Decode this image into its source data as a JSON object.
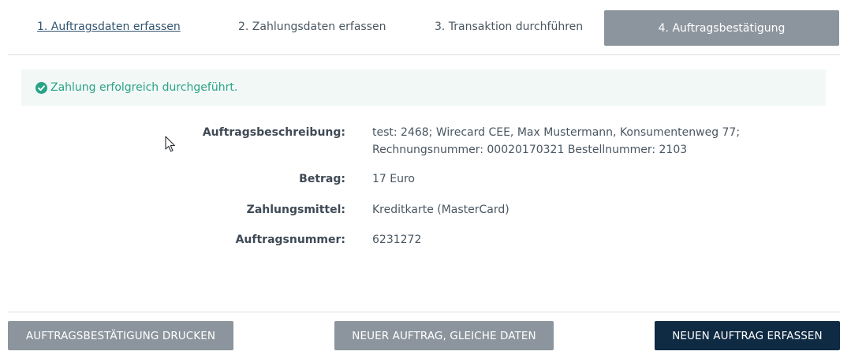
{
  "steps": [
    {
      "label": "1. Auftragsdaten erfassen"
    },
    {
      "label": "2. Zahlungsdaten erfassen"
    },
    {
      "label": "3. Transaktion durchführen"
    },
    {
      "label": "4. Auftragsbestätigung"
    }
  ],
  "alert": {
    "icon": "check-circle-icon",
    "text": "Zahlung erfolgreich durchgeführt.",
    "color": "#2aa386"
  },
  "details": {
    "description": {
      "label": "Auftragsbeschreibung:",
      "line1": "test: 2468; Wirecard CEE, Max Mustermann, Konsumentenweg 77;",
      "line2": "Rechnungsnummer: 00020170321 Bestellnummer: 2103"
    },
    "amount": {
      "label": "Betrag:",
      "value": "17 Euro"
    },
    "payment_method": {
      "label": "Zahlungsmittel:",
      "value": "Kreditkarte (MasterCard)"
    },
    "order_number": {
      "label": "Auftragsnummer:",
      "value": "6231272"
    }
  },
  "buttons": {
    "print": "AUFTRAGSBESTÄTIGUNG DRUCKEN",
    "new_same_data": "NEUER AUFTRAG, GLEICHE DATEN",
    "new_order": "NEUEN AUFTRAG ERFASSEN"
  },
  "colors": {
    "active_step": "#8c959d",
    "primary_button": "#0f2a43",
    "secondary_button": "#8c959d",
    "link": "#33546f"
  }
}
